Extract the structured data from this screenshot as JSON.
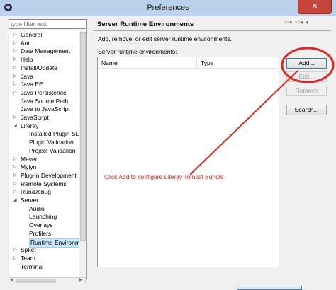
{
  "window": {
    "title": "Preferences",
    "close_glyph": "✕",
    "app_icon": "eclipse-icon"
  },
  "filter": {
    "placeholder": "type filter text",
    "value": ""
  },
  "tree": {
    "expanded_glyph": "◢",
    "collapsed_glyph": "▷",
    "items": [
      {
        "label": "General",
        "depth": 0,
        "twisty": "collapsed"
      },
      {
        "label": "Ant",
        "depth": 0,
        "twisty": "collapsed"
      },
      {
        "label": "Data Management",
        "depth": 0,
        "twisty": "collapsed"
      },
      {
        "label": "Help",
        "depth": 0,
        "twisty": "collapsed"
      },
      {
        "label": "Install/Update",
        "depth": 0,
        "twisty": "collapsed"
      },
      {
        "label": "Java",
        "depth": 0,
        "twisty": "collapsed"
      },
      {
        "label": "Java EE",
        "depth": 0,
        "twisty": "collapsed"
      },
      {
        "label": "Java Persistence",
        "depth": 0,
        "twisty": "collapsed"
      },
      {
        "label": "Java Source Path",
        "depth": 0,
        "twisty": "none"
      },
      {
        "label": "Java to JavaScript",
        "depth": 0,
        "twisty": "none"
      },
      {
        "label": "JavaScript",
        "depth": 0,
        "twisty": "collapsed"
      },
      {
        "label": "Liferay",
        "depth": 0,
        "twisty": "expanded"
      },
      {
        "label": "Installed Plugin SDK",
        "depth": 1,
        "twisty": "none"
      },
      {
        "label": "Plugin Validation",
        "depth": 1,
        "twisty": "none"
      },
      {
        "label": "Project Validation",
        "depth": 1,
        "twisty": "none"
      },
      {
        "label": "Maven",
        "depth": 0,
        "twisty": "collapsed"
      },
      {
        "label": "Mylyn",
        "depth": 0,
        "twisty": "collapsed"
      },
      {
        "label": "Plug-in Development",
        "depth": 0,
        "twisty": "collapsed"
      },
      {
        "label": "Remote Systems",
        "depth": 0,
        "twisty": "collapsed"
      },
      {
        "label": "Run/Debug",
        "depth": 0,
        "twisty": "collapsed"
      },
      {
        "label": "Server",
        "depth": 0,
        "twisty": "expanded"
      },
      {
        "label": "Audio",
        "depth": 1,
        "twisty": "none"
      },
      {
        "label": "Launching",
        "depth": 1,
        "twisty": "none"
      },
      {
        "label": "Overlays",
        "depth": 1,
        "twisty": "none"
      },
      {
        "label": "Profilers",
        "depth": 1,
        "twisty": "none"
      },
      {
        "label": "Runtime Environme",
        "depth": 1,
        "twisty": "none",
        "selected": true
      },
      {
        "label": "Spket",
        "depth": 0,
        "twisty": "collapsed"
      },
      {
        "label": "Team",
        "depth": 0,
        "twisty": "collapsed"
      },
      {
        "label": "Terminal",
        "depth": 0,
        "twisty": "none"
      }
    ]
  },
  "page": {
    "title": "Server Runtime Environments",
    "description": "Add, remove, or edit server runtime environments.",
    "environments_label": "Server runtime environments:",
    "nav": {
      "back_icon": "⇦",
      "forward_icon": "⇨",
      "dropdown_icon": "▾"
    }
  },
  "table": {
    "columns": [
      "Name",
      "Type"
    ],
    "rows": []
  },
  "buttons": {
    "add": {
      "label": "Add...",
      "enabled": true
    },
    "edit": {
      "label": "Edit...",
      "enabled": false
    },
    "remove": {
      "label": "Remove",
      "enabled": false
    },
    "search": {
      "label": "Search...",
      "enabled": true
    }
  },
  "annotation": {
    "text": "Click Add to configure Liferay Tomcat Bundle",
    "color": "#d8231f",
    "shapes": [
      "red-circle-around-add-button",
      "red-arrow-line"
    ]
  },
  "colors": {
    "titlebar": "#b9d1ea",
    "close": "#c7443a",
    "selection": "#cce8ff",
    "annotation": "#d8231f"
  }
}
